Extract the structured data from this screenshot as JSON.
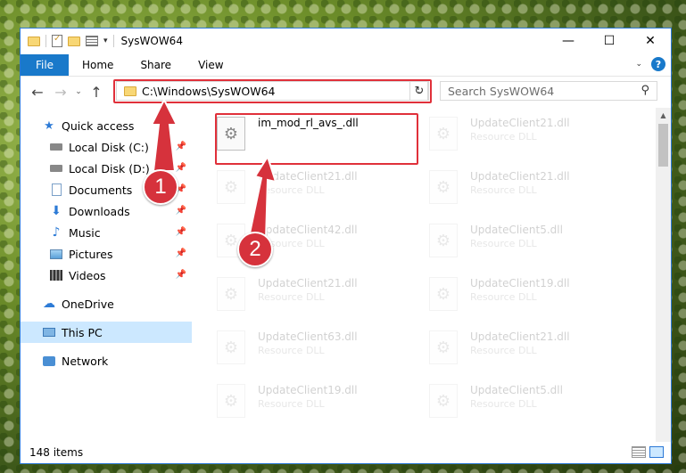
{
  "window": {
    "title": "SysWOW64",
    "controls": {
      "minimize": "—",
      "maximize": "☐",
      "close": "✕"
    }
  },
  "ribbon": {
    "file": "File",
    "tabs": [
      "Home",
      "Share",
      "View"
    ]
  },
  "nav": {
    "back": "←",
    "forward": "→",
    "recent": "⌄",
    "up": "↑",
    "address": "C:\\Windows\\SysWOW64",
    "refresh": "↻",
    "search_placeholder": "Search SysWOW64"
  },
  "sidebar": {
    "items": [
      {
        "label": "Quick access",
        "icon": "star-icon",
        "pinned": false
      },
      {
        "label": "Local Disk (C:)",
        "icon": "disk-icon",
        "pinned": true
      },
      {
        "label": "Local Disk (D:)",
        "icon": "disk-icon",
        "pinned": true
      },
      {
        "label": "Documents",
        "icon": "documents-icon",
        "pinned": true
      },
      {
        "label": "Downloads",
        "icon": "downloads-icon",
        "pinned": true
      },
      {
        "label": "Music",
        "icon": "music-icon",
        "pinned": true
      },
      {
        "label": "Pictures",
        "icon": "pictures-icon",
        "pinned": true
      },
      {
        "label": "Videos",
        "icon": "videos-icon",
        "pinned": true
      },
      {
        "label": "OneDrive",
        "icon": "cloud-icon",
        "pinned": false
      },
      {
        "label": "This PC",
        "icon": "pc-icon",
        "pinned": false,
        "selected": true
      },
      {
        "label": "Network",
        "icon": "network-icon",
        "pinned": false
      }
    ]
  },
  "files": [
    {
      "name": "im_mod_rl_avs_.dll",
      "type": "",
      "faded": false
    },
    {
      "name": "UpdateClient21.dll",
      "type": "Resource DLL",
      "faded": true
    },
    {
      "name": "UpdateClient21.dll",
      "type": "Resource DLL",
      "faded": true
    },
    {
      "name": "UpdateClient21.dll",
      "type": "Resource DLL",
      "faded": true
    },
    {
      "name": "UpdateClient42.dll",
      "type": "Resource DLL",
      "faded": true
    },
    {
      "name": "UpdateClient5.dll",
      "type": "Resource DLL",
      "faded": true
    },
    {
      "name": "UpdateClient21.dll",
      "type": "Resource DLL",
      "faded": true
    },
    {
      "name": "UpdateClient19.dll",
      "type": "Resource DLL",
      "faded": true
    },
    {
      "name": "UpdateClient63.dll",
      "type": "Resource DLL",
      "faded": true
    },
    {
      "name": "UpdateClient21.dll",
      "type": "Resource DLL",
      "faded": true
    },
    {
      "name": "UpdateClient19.dll",
      "type": "Resource DLL",
      "faded": true
    },
    {
      "name": "UpdateClient5.dll",
      "type": "Resource DLL",
      "faded": true
    }
  ],
  "status": {
    "item_count": "148 items"
  },
  "annotations": {
    "step1": "1",
    "step2": "2"
  },
  "colors": {
    "accent": "#1979ca",
    "highlight": "#e0303a",
    "selected": "#cce8ff"
  }
}
